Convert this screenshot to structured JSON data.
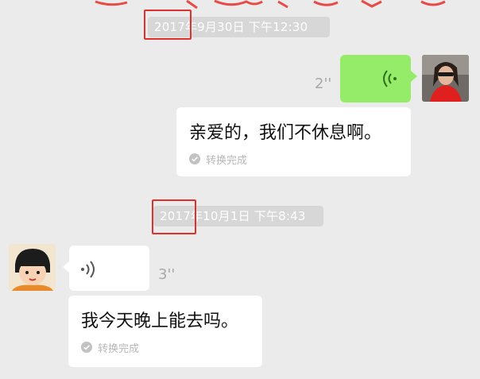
{
  "messages": [
    {
      "timestamp": "2017年9月30日 下午12:30",
      "sender": "self",
      "voice_duration": "2''",
      "transcript": "亲爱的，我们不休息啊。",
      "transcript_status": "转换完成"
    },
    {
      "timestamp": "2017年10月1日 下午8:43",
      "sender": "other",
      "voice_duration": "3''",
      "transcript": "我今天晚上能去吗。",
      "transcript_status": "转换完成"
    }
  ],
  "colors": {
    "background": "#ebebeb",
    "outgoing_bubble": "#95ec69",
    "incoming_bubble": "#ffffff",
    "timestamp_bg": "#d7d7d7",
    "highlight_border": "#e0302e"
  },
  "icons": {
    "voice_out": "voice-wave-icon",
    "voice_in": "voice-wave-icon",
    "status": "check-circle-icon"
  }
}
